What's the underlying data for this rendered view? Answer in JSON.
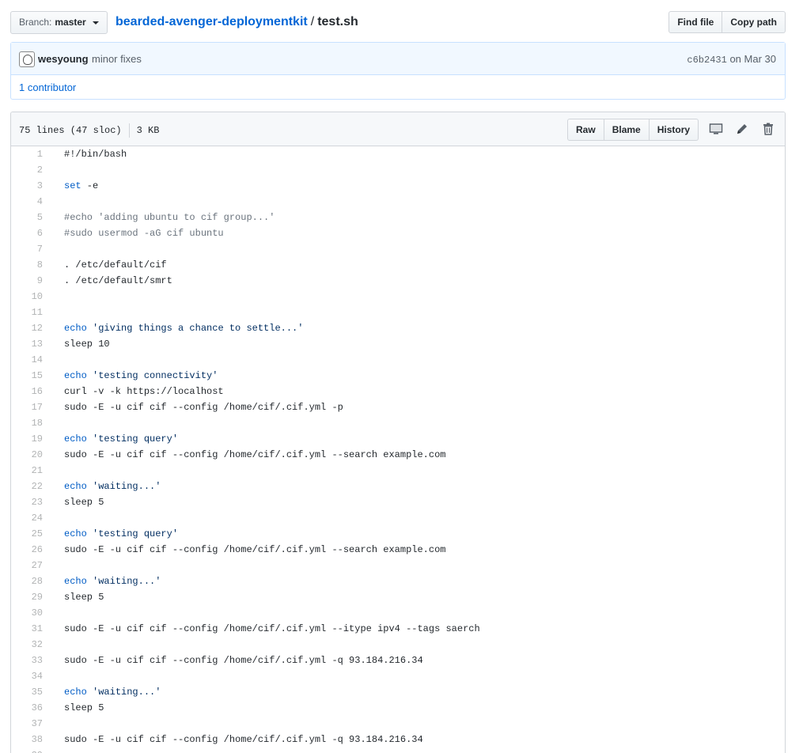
{
  "topbar": {
    "branch_label": "Branch:",
    "branch_value": "master",
    "repo": "bearded-avenger-deploymentkit",
    "separator": "/",
    "file": "test.sh",
    "find_file": "Find file",
    "copy_path": "Copy path"
  },
  "commit": {
    "author": "wesyoung",
    "message": "minor fixes",
    "sha": "c6b2431",
    "date": "on Mar 30",
    "contributors": "1 contributor"
  },
  "file": {
    "lines_info": "75 lines (47 sloc)",
    "size": "3 KB",
    "raw": "Raw",
    "blame": "Blame",
    "history": "History"
  },
  "icons": {
    "desktop": "desktop-icon",
    "pencil": "pencil-icon",
    "trash": "trash-icon"
  },
  "colors": {
    "link": "#0366d6",
    "keyword": "#005cc5",
    "commit_bg": "#f1f8ff"
  },
  "code_lines": [
    {
      "n": "1",
      "parts": [
        {
          "t": "#!/bin/bash",
          "c": ""
        }
      ]
    },
    {
      "n": "2",
      "parts": []
    },
    {
      "n": "3",
      "parts": [
        {
          "t": "set",
          "c": "kw"
        },
        {
          "t": " -e",
          "c": ""
        }
      ]
    },
    {
      "n": "4",
      "parts": []
    },
    {
      "n": "5",
      "parts": [
        {
          "t": "#echo 'adding ubuntu to cif group...'",
          "c": "cm"
        }
      ]
    },
    {
      "n": "6",
      "parts": [
        {
          "t": "#sudo usermod -aG cif ubuntu",
          "c": "cm"
        }
      ]
    },
    {
      "n": "7",
      "parts": []
    },
    {
      "n": "8",
      "parts": [
        {
          "t": ". /etc/default/cif",
          "c": ""
        }
      ]
    },
    {
      "n": "9",
      "parts": [
        {
          "t": ". /etc/default/smrt",
          "c": ""
        }
      ]
    },
    {
      "n": "10",
      "parts": []
    },
    {
      "n": "11",
      "parts": []
    },
    {
      "n": "12",
      "parts": [
        {
          "t": "echo",
          "c": "kw"
        },
        {
          "t": " 'giving things a chance to settle...'",
          "c": "str"
        }
      ]
    },
    {
      "n": "13",
      "parts": [
        {
          "t": "sleep 10",
          "c": ""
        }
      ]
    },
    {
      "n": "14",
      "parts": []
    },
    {
      "n": "15",
      "parts": [
        {
          "t": "echo",
          "c": "kw"
        },
        {
          "t": " 'testing connectivity'",
          "c": "str"
        }
      ]
    },
    {
      "n": "16",
      "parts": [
        {
          "t": "curl -v -k https://localhost",
          "c": ""
        }
      ]
    },
    {
      "n": "17",
      "parts": [
        {
          "t": "sudo -E -u cif cif --config /home/cif/.cif.yml -p",
          "c": ""
        }
      ]
    },
    {
      "n": "18",
      "parts": []
    },
    {
      "n": "19",
      "parts": [
        {
          "t": "echo",
          "c": "kw"
        },
        {
          "t": " 'testing query'",
          "c": "str"
        }
      ]
    },
    {
      "n": "20",
      "parts": [
        {
          "t": "sudo -E -u cif cif --config /home/cif/.cif.yml --search example.com",
          "c": ""
        }
      ]
    },
    {
      "n": "21",
      "parts": []
    },
    {
      "n": "22",
      "parts": [
        {
          "t": "echo",
          "c": "kw"
        },
        {
          "t": " 'waiting...'",
          "c": "str"
        }
      ]
    },
    {
      "n": "23",
      "parts": [
        {
          "t": "sleep 5",
          "c": ""
        }
      ]
    },
    {
      "n": "24",
      "parts": []
    },
    {
      "n": "25",
      "parts": [
        {
          "t": "echo",
          "c": "kw"
        },
        {
          "t": " 'testing query'",
          "c": "str"
        }
      ]
    },
    {
      "n": "26",
      "parts": [
        {
          "t": "sudo -E -u cif cif --config /home/cif/.cif.yml --search example.com",
          "c": ""
        }
      ]
    },
    {
      "n": "27",
      "parts": []
    },
    {
      "n": "28",
      "parts": [
        {
          "t": "echo",
          "c": "kw"
        },
        {
          "t": " 'waiting...'",
          "c": "str"
        }
      ]
    },
    {
      "n": "29",
      "parts": [
        {
          "t": "sleep 5",
          "c": ""
        }
      ]
    },
    {
      "n": "30",
      "parts": []
    },
    {
      "n": "31",
      "parts": [
        {
          "t": "sudo -E -u cif cif --config /home/cif/.cif.yml --itype ipv4 --tags saerch",
          "c": ""
        }
      ]
    },
    {
      "n": "32",
      "parts": []
    },
    {
      "n": "33",
      "parts": [
        {
          "t": "sudo -E -u cif cif --config /home/cif/.cif.yml -q 93.184.216.34",
          "c": ""
        }
      ]
    },
    {
      "n": "34",
      "parts": []
    },
    {
      "n": "35",
      "parts": [
        {
          "t": "echo",
          "c": "kw"
        },
        {
          "t": " 'waiting...'",
          "c": "str"
        }
      ]
    },
    {
      "n": "36",
      "parts": [
        {
          "t": "sleep 5",
          "c": ""
        }
      ]
    },
    {
      "n": "37",
      "parts": []
    },
    {
      "n": "38",
      "parts": [
        {
          "t": "sudo -E -u cif cif --config /home/cif/.cif.yml -q 93.184.216.34",
          "c": ""
        }
      ]
    },
    {
      "n": "39",
      "parts": []
    }
  ]
}
